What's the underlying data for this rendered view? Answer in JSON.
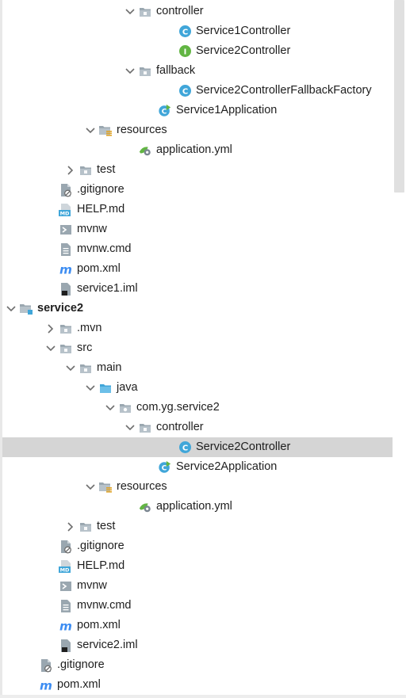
{
  "tree": {
    "rows": [
      {
        "label": "controller",
        "icon": "folder-icon",
        "arrow": "expanded",
        "depth": 7
      },
      {
        "label": "Service1Controller",
        "icon": "class-icon",
        "arrow": "none",
        "depth": 9
      },
      {
        "label": "Service2Controller",
        "icon": "interface-icon",
        "arrow": "none",
        "depth": 9
      },
      {
        "label": "fallback",
        "icon": "folder-icon",
        "arrow": "expanded",
        "depth": 7
      },
      {
        "label": "Service2ControllerFallbackFactory",
        "icon": "class-icon",
        "arrow": "none",
        "depth": 9
      },
      {
        "label": "Service1Application",
        "icon": "spring-boot-class-icon",
        "arrow": "none",
        "depth": 8
      },
      {
        "label": "resources",
        "icon": "resources-folder-icon",
        "arrow": "expanded",
        "depth": 5
      },
      {
        "label": "application.yml",
        "icon": "yml-config-icon",
        "arrow": "none",
        "depth": 7
      },
      {
        "label": "test",
        "icon": "folder-icon",
        "arrow": "collapsed",
        "depth": 4
      },
      {
        "label": ".gitignore",
        "icon": "gitignore-file-icon",
        "arrow": "none",
        "depth": 3
      },
      {
        "label": "HELP.md",
        "icon": "markdown-file-icon",
        "arrow": "none",
        "depth": 3
      },
      {
        "label": "mvnw",
        "icon": "shell-script-icon",
        "arrow": "none",
        "depth": 3
      },
      {
        "label": "mvnw.cmd",
        "icon": "text-file-icon",
        "arrow": "none",
        "depth": 3
      },
      {
        "label": "pom.xml",
        "icon": "maven-icon",
        "arrow": "none",
        "depth": 3
      },
      {
        "label": "service1.iml",
        "icon": "iml-file-icon",
        "arrow": "none",
        "depth": 3
      },
      {
        "label": "service2",
        "icon": "module-folder-icon",
        "arrow": "expanded",
        "depth": 1,
        "bold": true
      },
      {
        "label": ".mvn",
        "icon": "folder-icon",
        "arrow": "collapsed",
        "depth": 3
      },
      {
        "label": "src",
        "icon": "folder-icon",
        "arrow": "expanded",
        "depth": 3
      },
      {
        "label": "main",
        "icon": "folder-icon",
        "arrow": "expanded",
        "depth": 4
      },
      {
        "label": "java",
        "icon": "source-folder-icon",
        "arrow": "expanded",
        "depth": 5
      },
      {
        "label": "com.yg.service2",
        "icon": "package-icon",
        "arrow": "expanded",
        "depth": 6
      },
      {
        "label": "controller",
        "icon": "folder-icon",
        "arrow": "expanded",
        "depth": 7
      },
      {
        "label": "Service2Controller",
        "icon": "class-icon",
        "arrow": "none",
        "depth": 9,
        "selected": true
      },
      {
        "label": "Service2Application",
        "icon": "spring-boot-class-icon",
        "arrow": "none",
        "depth": 8
      },
      {
        "label": "resources",
        "icon": "resources-folder-icon",
        "arrow": "expanded",
        "depth": 5
      },
      {
        "label": "application.yml",
        "icon": "yml-config-icon",
        "arrow": "none",
        "depth": 7
      },
      {
        "label": "test",
        "icon": "folder-icon",
        "arrow": "collapsed",
        "depth": 4
      },
      {
        "label": ".gitignore",
        "icon": "gitignore-file-icon",
        "arrow": "none",
        "depth": 3
      },
      {
        "label": "HELP.md",
        "icon": "markdown-file-icon",
        "arrow": "none",
        "depth": 3
      },
      {
        "label": "mvnw",
        "icon": "shell-script-icon",
        "arrow": "none",
        "depth": 3
      },
      {
        "label": "mvnw.cmd",
        "icon": "text-file-icon",
        "arrow": "none",
        "depth": 3
      },
      {
        "label": "pom.xml",
        "icon": "maven-icon",
        "arrow": "none",
        "depth": 3
      },
      {
        "label": "service2.iml",
        "icon": "iml-file-icon",
        "arrow": "none",
        "depth": 3
      },
      {
        "label": ".gitignore",
        "icon": "gitignore-file-icon",
        "arrow": "none",
        "depth": 2
      },
      {
        "label": "pom.xml",
        "icon": "maven-icon",
        "arrow": "none",
        "depth": 2
      }
    ]
  },
  "colors": {
    "selection": "#d5d5d5",
    "folder": "#9aa7b0",
    "class": "#40a6d9",
    "interface": "#62b543",
    "maven": "#3d8df2",
    "source_folder": "#40a6d9"
  }
}
